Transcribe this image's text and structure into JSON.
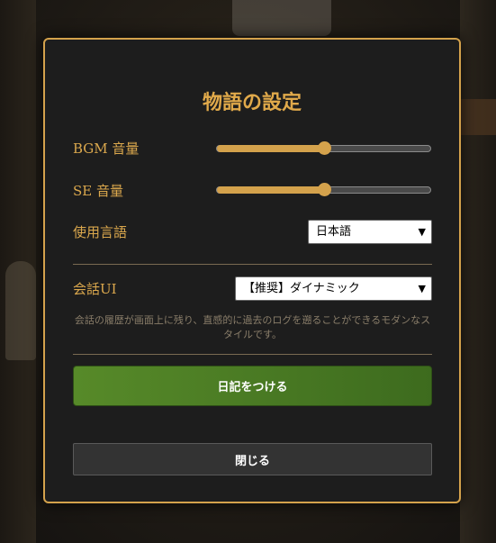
{
  "settings": {
    "title": "物語の設定",
    "bgm": {
      "label": "BGM 音量",
      "value": 0.5
    },
    "se": {
      "label": "SE 音量",
      "value": 0.5
    },
    "language": {
      "label": "使用言語",
      "selected": "日本語"
    },
    "conversation_ui": {
      "label": "会話UI",
      "selected": "【推奨】ダイナミック",
      "description": "会話の履歴が画面上に残り、直感的に過去のログを遡ることができるモダンなスタイルです。"
    },
    "diary_button": "日記をつける",
    "close_button": "閉じる"
  },
  "colors": {
    "accent": "#d4a24c",
    "panel_bg": "#1d1d1d",
    "primary_button": "#4f7f25",
    "secondary_button": "#333333"
  },
  "icons": {
    "select_arrow": "chevron-down-icon"
  }
}
